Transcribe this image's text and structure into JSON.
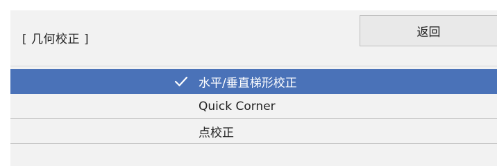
{
  "header": {
    "title": "[ 几何校正 ]",
    "back_label": "返回"
  },
  "menu": {
    "items": [
      {
        "label": "水平/垂直梯形校正",
        "selected": true,
        "icon": "check-icon"
      },
      {
        "label": "Quick Corner",
        "selected": false
      },
      {
        "label": "点校正",
        "selected": false
      }
    ]
  },
  "colors": {
    "selected_bg": "#4a72b8",
    "panel_bg": "#f2f2f2",
    "button_bg": "#e9e9e9"
  }
}
